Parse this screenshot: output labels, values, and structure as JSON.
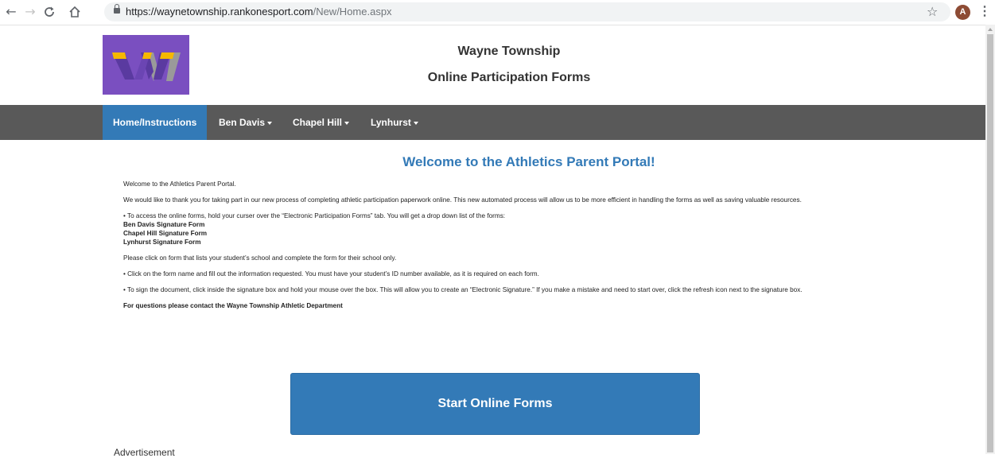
{
  "browser": {
    "back_icon": "←",
    "forward_icon": "→",
    "reload_icon": "C",
    "home_icon": "⌂",
    "url_host": "https://waynetownship.rankonesport.com",
    "url_path": "/New/Home.aspx",
    "bookmark_icon": "☆",
    "avatar_letter": "A",
    "menu_icon": "⋮"
  },
  "header": {
    "title": "Wayne Township",
    "subtitle": "Online Participation Forms"
  },
  "nav": {
    "items": [
      {
        "label": "Home/Instructions"
      },
      {
        "label": "Ben Davis"
      },
      {
        "label": "Chapel Hill"
      },
      {
        "label": "Lynhurst"
      }
    ]
  },
  "content": {
    "heading": "Welcome to the Athletics Parent Portal!",
    "p1": "Welcome to the Athletics Parent Portal.",
    "p2": "We would like to thank you for taking part in our new process of completing athletic participation paperwork online. This new automated process will allow us to be more efficient in handling the forms as well as saving valuable resources.",
    "p3": "• To access the online forms, hold your curser over the “Electronic Participation Forms” tab. You will get a drop down list of the forms:",
    "forms": [
      "Ben Davis Signature Form",
      "Chapel Hill Signature Form",
      "Lynhurst Signature Form"
    ],
    "p4": "Please click on form that lists your student’s school and complete the form for their school only.",
    "p5": "• Click on the form name and fill out the information requested. You must have your student’s ID number available, as it is required on each form.",
    "p6": "• To sign the document, click inside the signature box and hold your mouse over the box. This will allow you to create an “Electronic Signature.” If you make a mistake and need to start over, click the refresh icon next to the signature box.",
    "contact": "For questions please contact the Wayne Township Athletic Department"
  },
  "start_button": "Start Online Forms",
  "bottom_text": "Advertisement",
  "colors": {
    "primary": "#337ab7",
    "navbar": "#595959",
    "logo_bg": "#7a4fc0",
    "logo_yellow": "#f6b800",
    "logo_grey": "#9a9a9a"
  }
}
